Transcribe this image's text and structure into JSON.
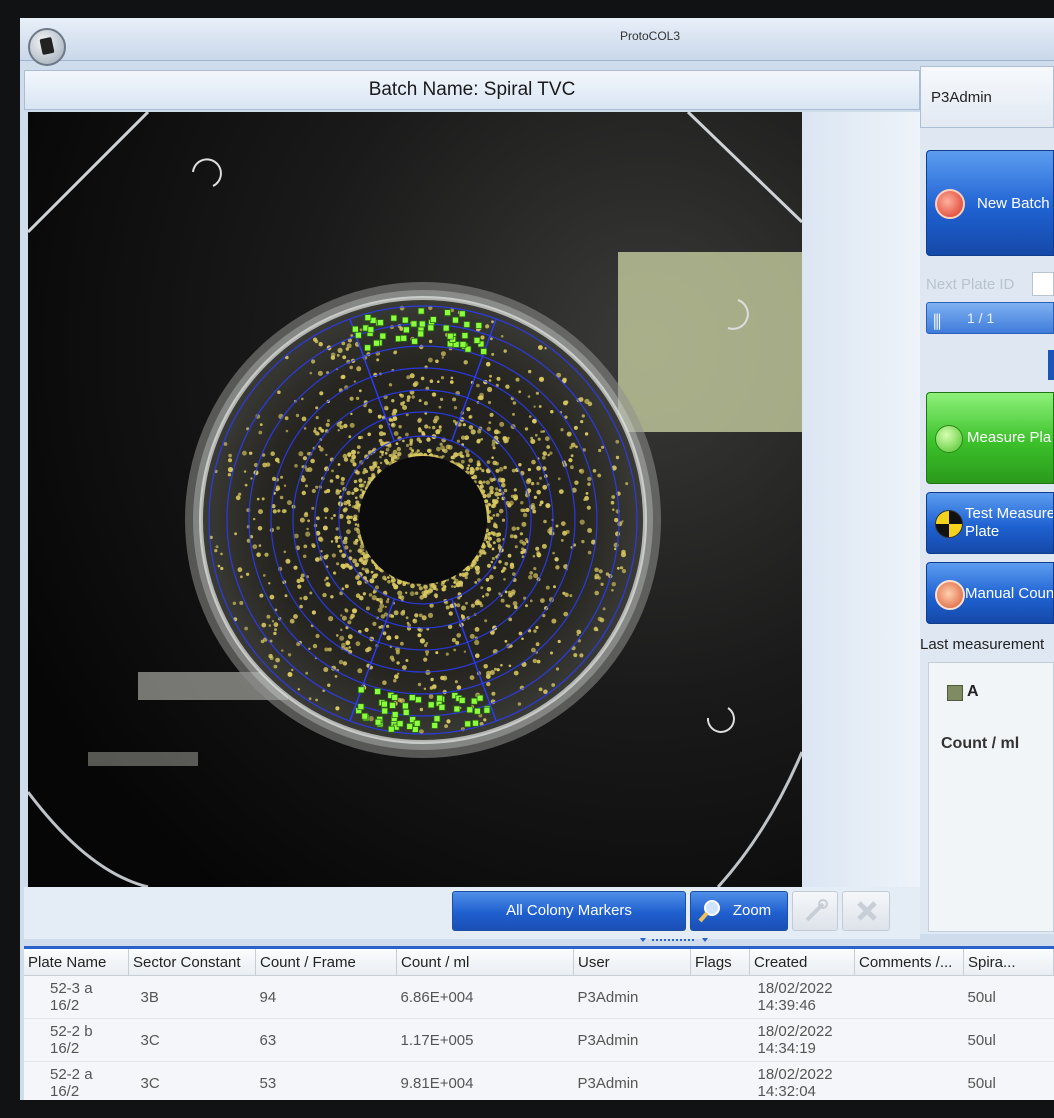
{
  "window": {
    "title": "ProtoCOL3"
  },
  "batch": {
    "header": "Batch Name: Spiral TVC"
  },
  "image_toolbar": {
    "colony_markers_label": "All Colony Markers",
    "zoom_label": "Zoom"
  },
  "right_panel": {
    "user": "P3Admin",
    "new_batch_label": "New Batch",
    "next_plate_label": "Next Plate ID",
    "plate_combo_value": "1 / 1",
    "measure_plate_label": "Measure Pla",
    "test_measure_line1": "Test Measure",
    "test_measure_line2": "Plate",
    "manual_count_label": "Manual Coun",
    "last_measurement_label": "Last measurement",
    "result_sector": "A",
    "result_unit_label": "Count / ml"
  },
  "table": {
    "headers": [
      "Plate Name",
      "Sector Constant",
      "Count / Frame",
      "Count / ml",
      "User",
      "Flags",
      "Created",
      "Comments /...",
      "Spira..."
    ],
    "rows": [
      {
        "plate_l1": "52-3 a",
        "plate_l2": "16/2",
        "sector": "3B",
        "frame": "94",
        "ml": "6.86E+004",
        "user": "P3Admin",
        "flags": "",
        "date": "18/02/2022",
        "time": "14:39:46",
        "comments": "",
        "spiral": "50ul"
      },
      {
        "plate_l1": "52-2 b",
        "plate_l2": "16/2",
        "sector": "3C",
        "frame": "63",
        "ml": "1.17E+005",
        "user": "P3Admin",
        "flags": "",
        "date": "18/02/2022",
        "time": "14:34:19",
        "comments": "",
        "spiral": "50ul"
      },
      {
        "plate_l1": "52-2 a",
        "plate_l2": "16/2",
        "sector": "3C",
        "frame": "53",
        "ml": "9.81E+004",
        "user": "P3Admin",
        "flags": "",
        "date": "18/02/2022",
        "time": "14:32:04",
        "comments": "",
        "spiral": "50ul"
      }
    ]
  },
  "colors": {
    "accent_blue": "#1f5fcf",
    "measure_green": "#3bc12a",
    "colony_yellow": "#d8c860",
    "marker_green": "#8cff3c",
    "sector_line_blue": "#2a3cff"
  }
}
